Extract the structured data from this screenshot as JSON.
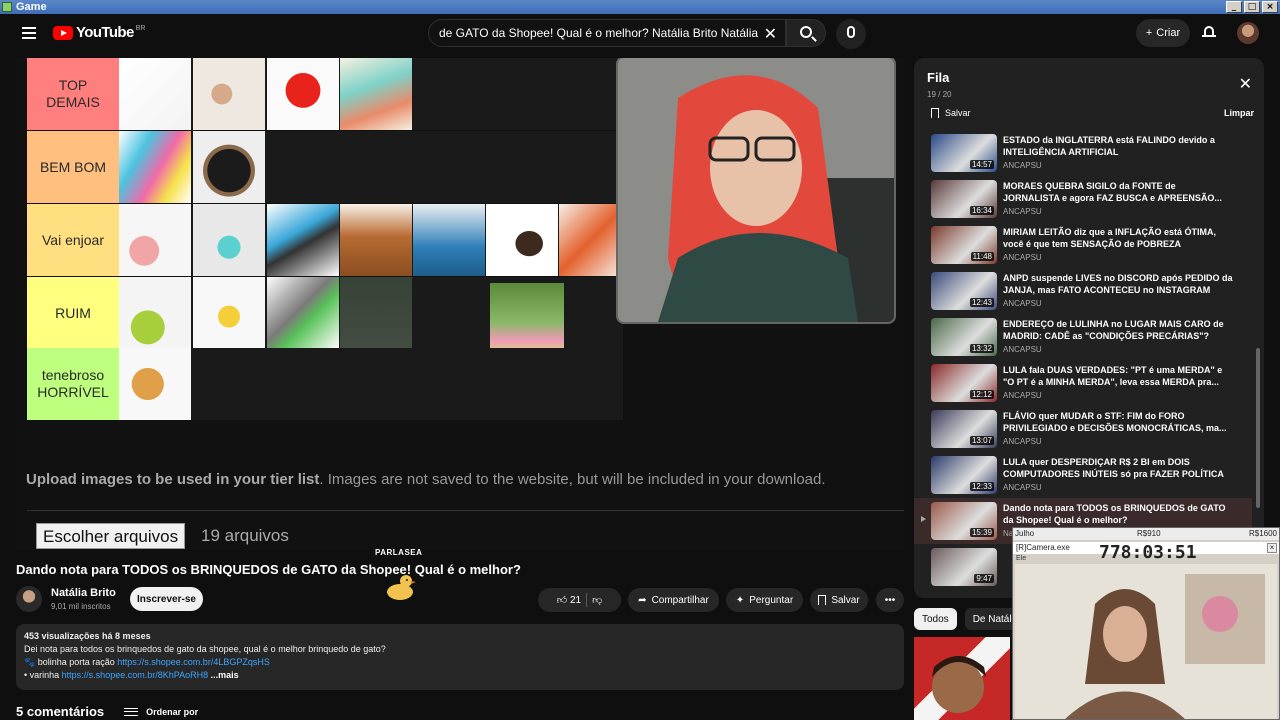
{
  "window": {
    "title": "Game"
  },
  "header": {
    "logo_text": "YouTube",
    "region": "BR",
    "search_query": "de GATO da Shopee! Qual é o melhor? Natália Brito  Natália Brito",
    "create_label": "Criar"
  },
  "tierlist": {
    "tiers": [
      {
        "label": "TOP\nDEMAIS",
        "color": "#ff7f7f"
      },
      {
        "label": "BEM BOM",
        "color": "#ffbf7f"
      },
      {
        "label": "Vai enjoar",
        "color": "#ffdf7f"
      },
      {
        "label": "RUIM",
        "color": "#ffff7f"
      },
      {
        "label": "tenebroso\nHORRÍVEL",
        "color": "#bfff7f"
      }
    ],
    "upload_bold": "Upload images to be used in your tier list",
    "upload_rest": ". Images are not saved to the website, but will be included in your download.",
    "file_button": "Escolher arquivos",
    "file_count": "19 arquivos"
  },
  "overlay_brand": "PARLASEA",
  "video": {
    "title": "Dando nota para TODOS os BRINQUEDOS de GATO da Shopee! Qual é o melhor?",
    "channel": "Natália Brito",
    "subscribers": "9,01 mil inscritos",
    "subscribe_label": "Inscrever-se",
    "likes": "21",
    "share_label": "Compartilhar",
    "ask_label": "Perguntar",
    "save_label": "Salvar",
    "more_label": "•••"
  },
  "description": {
    "meta": "453 visualizações  há 8 meses",
    "line1": "Dei nota para todos os brinquedos de gato da shopee, qual é o melhor brinquedo de gato?",
    "line2_prefix": "🐾 bolinha porta ração ",
    "line2_link": "https://s.shopee.com.br/4LBGPZqsHS",
    "line3_prefix": "• varinha ",
    "line3_link": "https://s.shopee.com.br/8KhPAoRH8",
    "more": "...mais"
  },
  "comments": {
    "count": "5 comentários",
    "sort": "Ordenar por"
  },
  "queue": {
    "title": "Fila",
    "count": "19 / 20",
    "save": "Salvar",
    "clear": "Limpar",
    "items": [
      {
        "title": "ESTADO da INGLATERRA está FALINDO devido a INTELIGÊNCIA ARTIFICIAL",
        "channel": "ANCAPSU",
        "duration": "14:57"
      },
      {
        "title": "MORAES QUEBRA SIGILO da FONTE de JORNALISTA e agora FAZ BUSCA e APREENSÃO...",
        "channel": "ANCAPSU",
        "duration": "16:34"
      },
      {
        "title": "MIRIAM LEITÃO diz que a INFLAÇÃO está ÓTIMA, você é que tem SENSAÇÃO de POBREZA",
        "channel": "ANCAPSU",
        "duration": "11:48"
      },
      {
        "title": "ANPD suspende LIVES no DISCORD após PEDIDO da JANJA, mas FATO ACONTECEU no INSTAGRAM",
        "channel": "ANCAPSU",
        "duration": "12:43"
      },
      {
        "title": "ENDEREÇO de LULINHA no LUGAR MAIS CARO de MADRID: CADÊ as \"CONDIÇÕES PRECÁRIAS\"?",
        "channel": "ANCAPSU",
        "duration": "13:32"
      },
      {
        "title": "LULA fala DUAS VERDADES: \"PT é uma MERDA\" e \"O PT é a MINHA MERDA\", leva essa MERDA pra...",
        "channel": "ANCAPSU",
        "duration": "12:12"
      },
      {
        "title": "FLÁVIO quer MUDAR o STF: FIM do FORO PRIVILEGIADO e DECISÕES MONOCRÁTICAS, ma...",
        "channel": "ANCAPSU",
        "duration": "13:07"
      },
      {
        "title": "LULA quer DESPERDIÇAR R$ 2 BI em DOIS COMPUTADORES INÚTEIS só pra FAZER POLÍTICA",
        "channel": "ANCAPSU",
        "duration": "12:33"
      },
      {
        "title": "Dando nota para TODOS os BRINQUEDOS de GATO da Shopee! Qual é o melhor?",
        "channel": "Natália Brito",
        "duration": "15:39"
      },
      {
        "title": "",
        "channel": "",
        "duration": "9:47"
      }
    ]
  },
  "chips": {
    "all": "Todos",
    "from": "De Natália"
  },
  "overlay": {
    "user": "Julho",
    "amount_mid": "R$910",
    "amount_right": "R$1600",
    "window_title": "[R]Camera.exe",
    "timer": "778:03:51",
    "sub": "Ele"
  },
  "colors": {
    "accent_red": "#ff0000",
    "link": "#3ea6ff",
    "queue_bg": "#212121"
  }
}
